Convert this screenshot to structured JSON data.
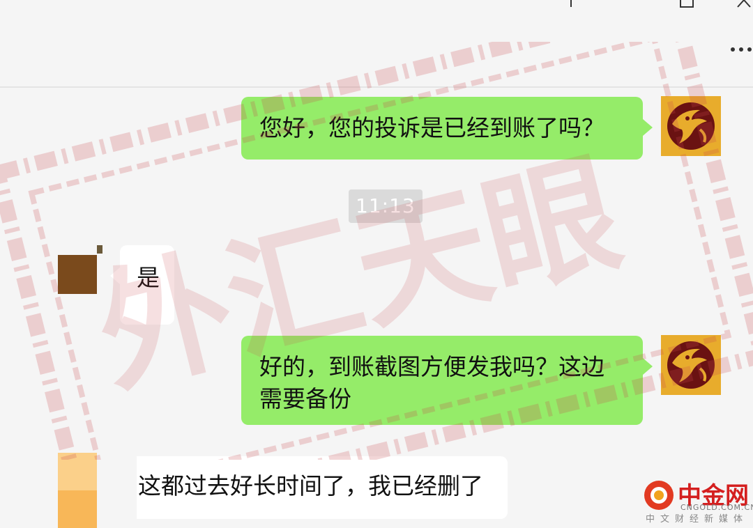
{
  "window": {
    "controls": [
      "pin-icon",
      "minimize-icon",
      "maximize-icon",
      "close-icon"
    ],
    "more_icon": "more-icon"
  },
  "watermark": {
    "text": "外汇天眼"
  },
  "messages": [
    {
      "side": "right",
      "text": "您好，您的投诉是已经到账了吗？"
    },
    {
      "side": "left",
      "text": "是"
    },
    {
      "side": "right",
      "text": "好的，到账截图方便发我吗？这边需要备份"
    },
    {
      "side": "left",
      "text": "这都过去好长时间了，我已经删了"
    }
  ],
  "timestamp": "11:13",
  "brand": {
    "name": "中金网",
    "url": "CNGOLD.COM.CN",
    "subtitle": "中文财经新媒体"
  },
  "colors": {
    "bubble_sent": "#95ec69",
    "bubble_received": "#ffffff",
    "background": "#f5f5f5",
    "logo_bg": "#e8ac2c",
    "logo_fg": "#6a1212",
    "watermark": "#c9484e",
    "brand_red": "#d41f1f"
  }
}
